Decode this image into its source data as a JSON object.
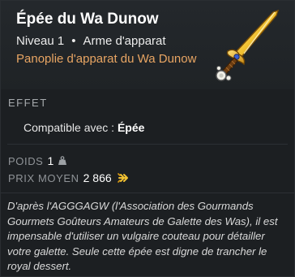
{
  "item": {
    "name": "Épée du Wa Dunow",
    "level": "Niveau 1",
    "separator": "•",
    "type": "Arme d'apparat",
    "set_name": "Panoplie d'apparat du Wa Dunow",
    "icon": "sword-icon"
  },
  "effects": {
    "header": "EFFET",
    "compat_label": "Compatible avec :",
    "compat_value": "Épée"
  },
  "stats": {
    "weight_label": "POIDS",
    "weight_value": "1",
    "weight_icon": "weight-icon",
    "price_label": "PRIX MOYEN",
    "price_value": "2 866",
    "price_icon": "kama-icon"
  },
  "description": "D'après l'AGGGAGW (l'Association des Gourmands Gourmets Goûteurs Amateurs de Galette des Was), il est impensable d'utiliser un vulgaire couteau pour détailler votre galette. Seule cette épée est digne de trancher le royal dessert.",
  "colors": {
    "set_name": "#e8a563",
    "background": "#1c1f22"
  }
}
